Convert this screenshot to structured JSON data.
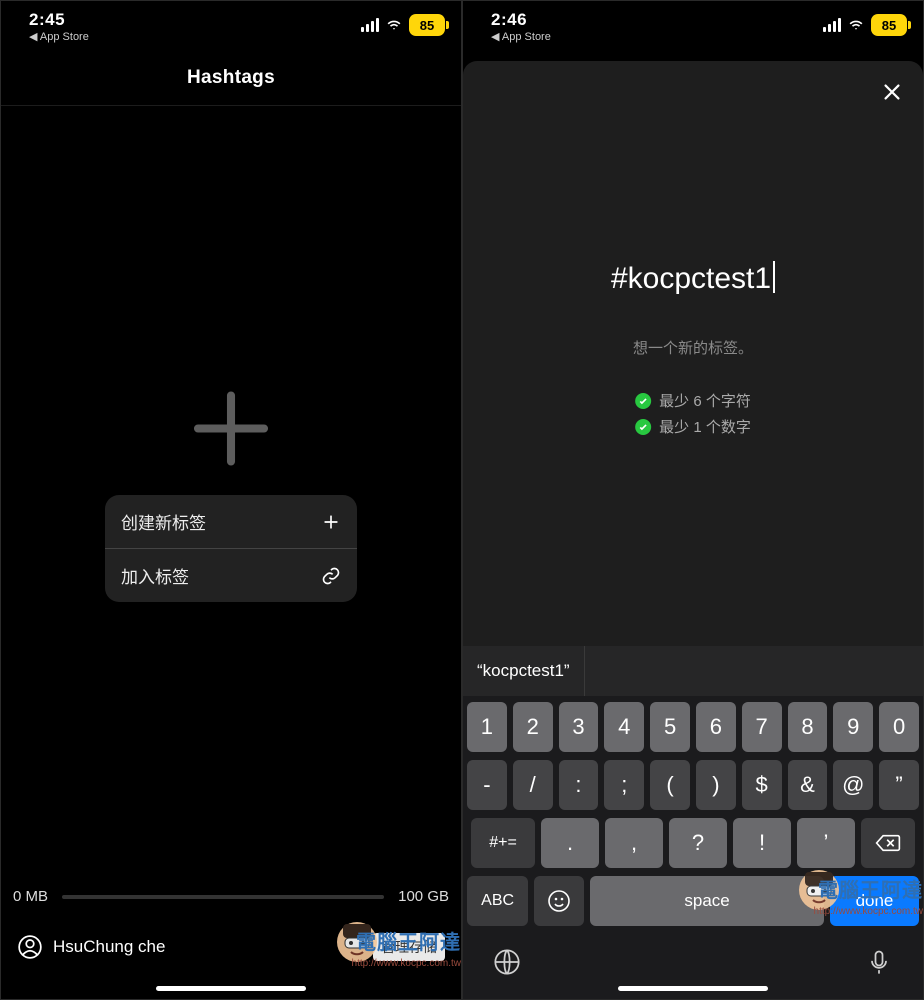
{
  "statusA": {
    "time": "2:45",
    "back": "App Store",
    "battery": "85"
  },
  "statusB": {
    "time": "2:46",
    "back": "App Store",
    "battery": "85"
  },
  "screenA": {
    "title": "Hashtags",
    "menu": {
      "create": "创建新标签",
      "join": "加入标签"
    },
    "storage": {
      "used": "0 MB",
      "total": "100 GB"
    },
    "user": {
      "name": "HsuChung che",
      "manage": "管理存储"
    }
  },
  "screenB": {
    "input": "#kocpctest1",
    "hint": "想一个新的标签。",
    "rules": {
      "r1": "最少 6 个字符",
      "r2": "最少 1 个数字"
    },
    "suggestion": "“kocpctest1”",
    "keys": {
      "row1": [
        "1",
        "2",
        "3",
        "4",
        "5",
        "6",
        "7",
        "8",
        "9",
        "0"
      ],
      "row2": [
        "-",
        "/",
        ":",
        ";",
        "(",
        ")",
        "$",
        "&",
        "@",
        "”"
      ],
      "row3mod": "#+=",
      "row3": [
        ".",
        ",",
        "?",
        "!",
        "’"
      ],
      "abc": "ABC",
      "space": "space",
      "done": "done"
    }
  },
  "watermark": {
    "text": "電腦王阿達",
    "sub": "http://www.kocpc.com.tw"
  }
}
